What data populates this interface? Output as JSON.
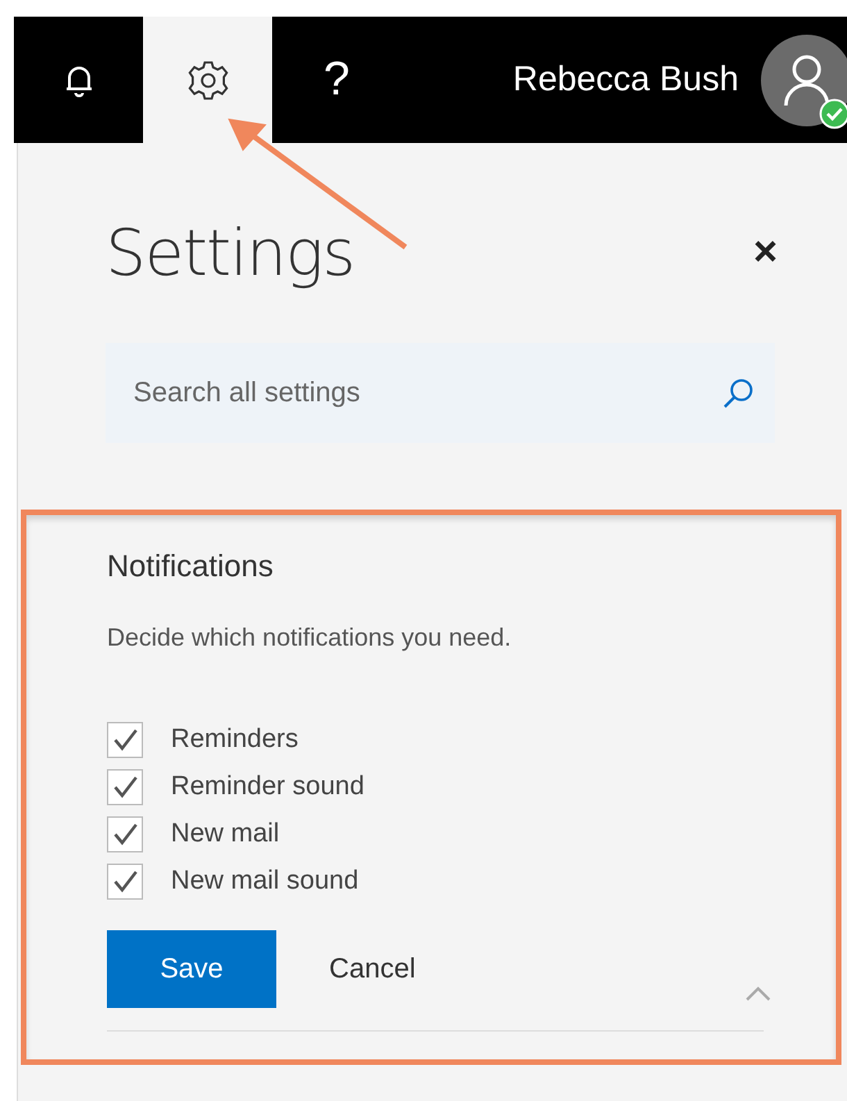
{
  "top_bar": {
    "items": [
      {
        "kind": "bell",
        "selected": false
      },
      {
        "kind": "gear",
        "selected": true
      },
      {
        "kind": "help",
        "label": "?",
        "selected": false
      }
    ],
    "user_name": "Rebecca Bush",
    "online": true
  },
  "panel": {
    "title": "Settings",
    "close": "×",
    "search": {
      "placeholder": "Search all settings"
    }
  },
  "notifications": {
    "title": "Notifications",
    "description": "Decide which notifications you need.",
    "options": [
      {
        "label": "Reminders",
        "checked": true
      },
      {
        "label": "Reminder sound",
        "checked": true
      },
      {
        "label": "New mail",
        "checked": true
      },
      {
        "label": "New mail sound",
        "checked": true
      }
    ],
    "buttons": [
      {
        "kind": "primary",
        "label": "Save"
      },
      {
        "kind": "link",
        "label": "Cancel"
      }
    ],
    "expanded": true
  }
}
